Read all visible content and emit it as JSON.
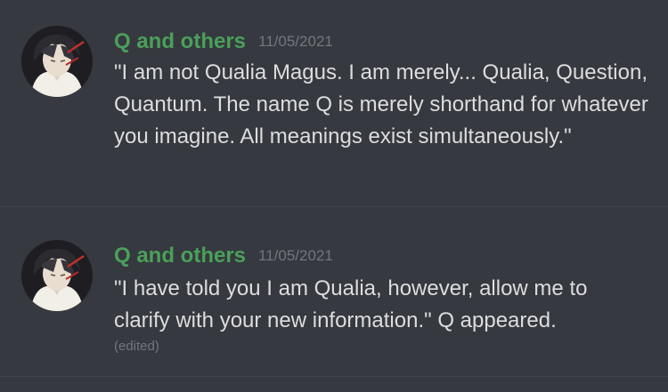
{
  "messages": [
    {
      "author": "Q and others",
      "timestamp": "11/05/2021",
      "text": "\"I am not Qualia Magus. I am merely... Qualia, Question, Quantum. The name Q is merely shorthand for whatever you imagine. All meanings exist simultaneously.\"",
      "edited": ""
    },
    {
      "author": "Q and others",
      "timestamp": "11/05/2021",
      "text": "\"I have told you I am Qualia, however, allow me to clarify with your new information.\" Q appeared.",
      "edited": "(edited)"
    }
  ],
  "colors": {
    "background": "#36393f",
    "username": "#4aa05a",
    "text": "#dcddde",
    "muted": "#72767d",
    "divider": "#40444b"
  },
  "icons": {
    "avatar": "dark-haired-character-avatar"
  }
}
